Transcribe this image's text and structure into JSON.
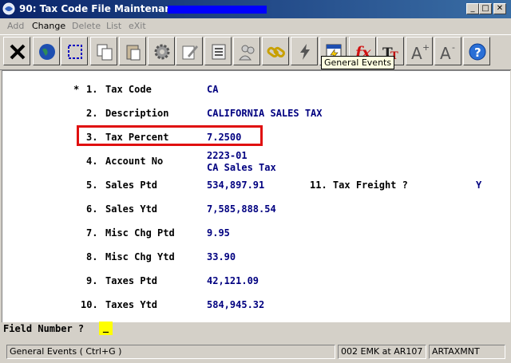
{
  "window": {
    "title": "90: Tax Code File Maintenance -"
  },
  "menu": [
    {
      "label": "Add",
      "enabled": false
    },
    {
      "label": "Change",
      "enabled": true
    },
    {
      "label": "Delete",
      "enabled": false
    },
    {
      "label": "List",
      "enabled": false
    },
    {
      "label": "eXit",
      "enabled": false
    }
  ],
  "toolbar": {
    "icons": [
      "exit-icon",
      "globe-icon",
      "select-icon",
      "copy-icon",
      "paste-icon",
      "settings-icon",
      "edit-icon",
      "list-icon",
      "users-icon",
      "link-icon",
      "lightning-icon",
      "general-events-icon",
      "function-icon",
      "font-icon",
      "font-increase-icon",
      "font-decrease-icon",
      "help-icon"
    ],
    "tooltip": "General Events"
  },
  "fields": [
    {
      "marker": "*",
      "num": "1.",
      "label": "Tax Code",
      "value": "CA"
    },
    {
      "marker": "",
      "num": "2.",
      "label": "Description",
      "value": "CALIFORNIA SALES TAX"
    },
    {
      "marker": "",
      "num": "3.",
      "label": "Tax Percent",
      "value": "7.2500"
    },
    {
      "marker": "",
      "num": "4.",
      "label": "Account No",
      "value": "2223-01",
      "subvalue": "CA Sales Tax"
    },
    {
      "marker": "",
      "num": "5.",
      "label": "Sales Ptd",
      "value": "534,897.91"
    },
    {
      "marker": "",
      "num": "6.",
      "label": "Sales Ytd",
      "value": "7,585,888.54"
    },
    {
      "marker": "",
      "num": "7.",
      "label": "Misc Chg Ptd",
      "value": "9.95"
    },
    {
      "marker": "",
      "num": "8.",
      "label": "Misc Chg Ytd",
      "value": "33.90"
    },
    {
      "marker": "",
      "num": "9.",
      "label": "Taxes Ptd",
      "value": "42,121.09"
    },
    {
      "marker": "",
      "num": "10.",
      "label": "Taxes Ytd",
      "value": "584,945.32"
    }
  ],
  "field11": {
    "num": "11.",
    "label": "Tax Freight ?",
    "value": "Y"
  },
  "prompt": {
    "label": "Field Number ?",
    "input": "_"
  },
  "status": {
    "hint": "General Events ( Ctrl+G )",
    "session": "002 EMK at AR107",
    "program": "ARTAXMNT"
  },
  "colors": {
    "title": "#0a246a",
    "value": "#000080",
    "highlight": "#e01010",
    "input": "#ffff00"
  }
}
